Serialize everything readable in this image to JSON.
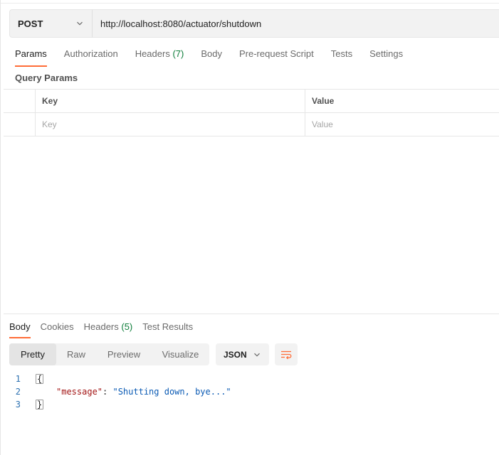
{
  "request": {
    "method": "POST",
    "url": "http://localhost:8080/actuator/shutdown"
  },
  "request_tabs": [
    {
      "label": "Params",
      "active": true
    },
    {
      "label": "Authorization"
    },
    {
      "label": "Headers",
      "count": "(7)"
    },
    {
      "label": "Body"
    },
    {
      "label": "Pre-request Script"
    },
    {
      "label": "Tests"
    },
    {
      "label": "Settings"
    }
  ],
  "query_params": {
    "title": "Query Params",
    "columns": {
      "key": "Key",
      "value": "Value"
    },
    "placeholders": {
      "key": "Key",
      "value": "Value"
    }
  },
  "response_tabs": [
    {
      "label": "Body",
      "active": true
    },
    {
      "label": "Cookies"
    },
    {
      "label": "Headers",
      "count": "(5)"
    },
    {
      "label": "Test Results"
    }
  ],
  "response_view": {
    "modes": [
      "Pretty",
      "Raw",
      "Preview",
      "Visualize"
    ],
    "active_mode": "Pretty",
    "format": "JSON"
  },
  "response_body": {
    "lines": [
      {
        "num": "1",
        "text": "{"
      },
      {
        "num": "2",
        "key": "\"message\"",
        "sep": ": ",
        "value": "\"Shutting down, bye...\""
      },
      {
        "num": "3",
        "text": "}"
      }
    ]
  },
  "colors": {
    "accent": "#ff6c37",
    "count": "#0d7d3a",
    "json_key": "#a31515",
    "json_string": "#0a5ab4"
  },
  "icons": {
    "method_dropdown": "chevron-down-icon",
    "format_dropdown": "chevron-down-icon",
    "wrap": "wrap-lines-icon"
  }
}
